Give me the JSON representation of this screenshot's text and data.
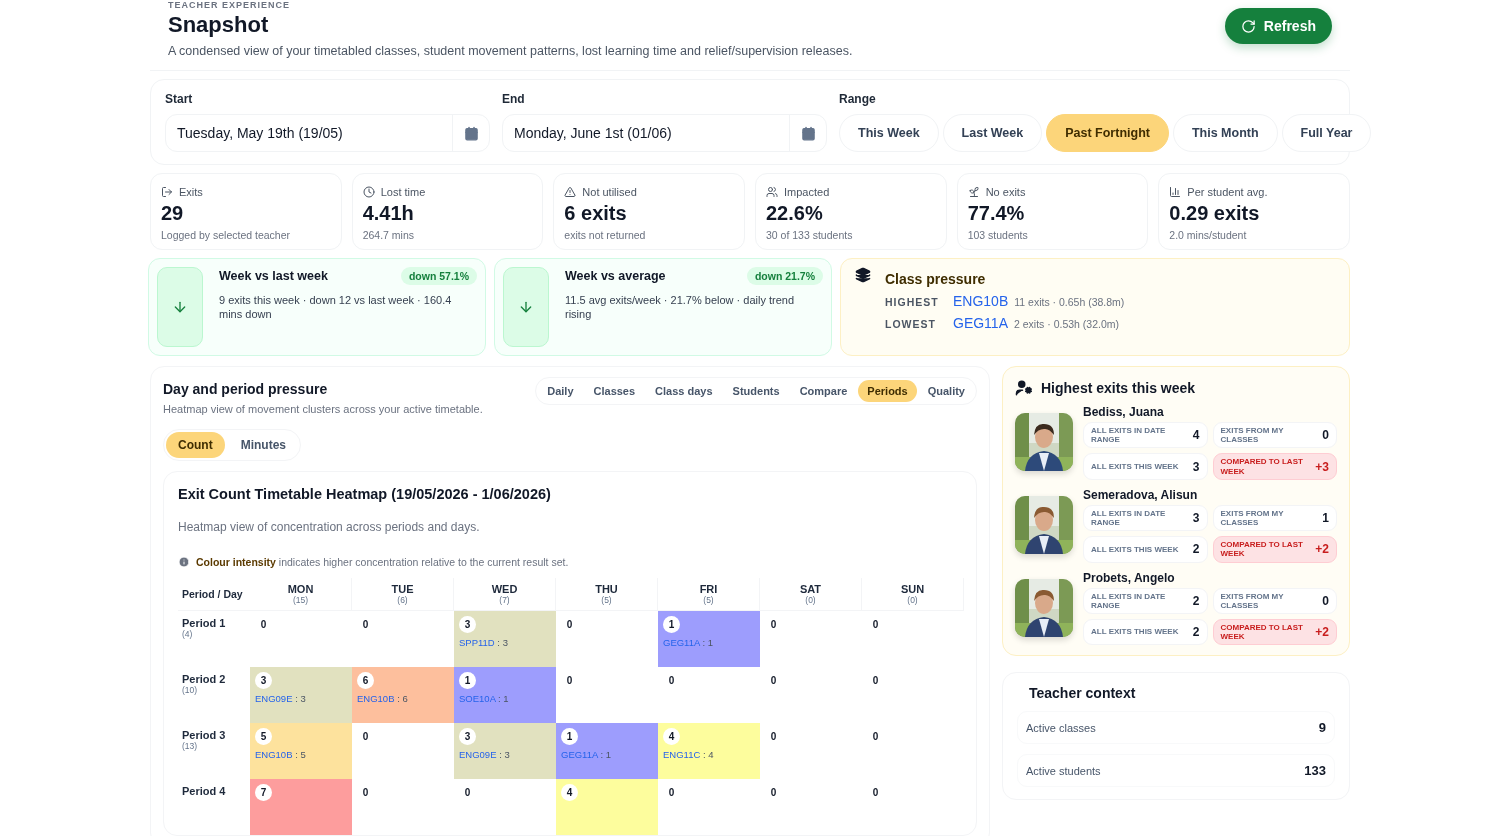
{
  "header": {
    "eyebrow": "TEACHER EXPERIENCE",
    "title": "Snapshot",
    "description": "A condensed view of your timetabled classes, student movement patterns, lost learning time and relief/supervision releases.",
    "refresh_button": "Refresh"
  },
  "filters": {
    "start": {
      "label": "Start",
      "value": "Tuesday, May 19th (19/05)"
    },
    "end": {
      "label": "End",
      "value": "Monday, June 1st (01/06)"
    },
    "range": {
      "label": "Range",
      "options": [
        {
          "label": "This Week",
          "selected": false
        },
        {
          "label": "Last Week",
          "selected": false
        },
        {
          "label": "Past Fortnight",
          "selected": true
        },
        {
          "label": "This Month",
          "selected": false
        },
        {
          "label": "Full Year",
          "selected": false
        }
      ]
    }
  },
  "stats": [
    {
      "kind": "exits",
      "label": "Exits",
      "value": "29",
      "note": "Logged by selected teacher"
    },
    {
      "kind": "clock",
      "label": "Lost time",
      "value": "4.41h",
      "note": "264.7 mins"
    },
    {
      "kind": "warning",
      "label": "Not utilised",
      "value": "6 exits",
      "note": "exits not returned"
    },
    {
      "kind": "people",
      "label": "Impacted",
      "value": "22.6%",
      "note": "30 of 133 students"
    },
    {
      "kind": "sprout",
      "label": "No exits",
      "value": "77.4%",
      "note": "103 students"
    },
    {
      "kind": "bars",
      "label": "Per student avg.",
      "value": "0.29 exits",
      "note": "2.0 mins/student"
    }
  ],
  "trends": [
    {
      "title": "Week vs last week",
      "badge": "down 57.1%",
      "kind": "down",
      "text": "9 exits this week · down 12 vs last week · 160.4 mins down"
    },
    {
      "title": "Week vs average",
      "badge": "down 21.7%",
      "kind": "down",
      "text": "11.5 avg exits/week · 21.7% below · daily trend rising"
    }
  ],
  "class_pressure": {
    "title": "Class pressure",
    "rows": [
      {
        "label": "HIGHEST",
        "class": "ENG10B",
        "detail": "11 exits · 0.65h (38.8m)"
      },
      {
        "label": "LOWEST",
        "class": "GEG11A",
        "detail": "2 exits · 0.53h (32.0m)"
      }
    ]
  },
  "pressure": {
    "title": "Day and period pressure",
    "subtitle": "Heatmap view of movement clusters across your active timetable.",
    "tabs": [
      {
        "label": "Daily",
        "selected": false
      },
      {
        "label": "Classes",
        "selected": false
      },
      {
        "label": "Class days",
        "selected": false
      },
      {
        "label": "Students",
        "selected": false
      },
      {
        "label": "Compare",
        "selected": false
      },
      {
        "label": "Periods",
        "selected": true
      },
      {
        "label": "Quality",
        "selected": false
      }
    ],
    "modes": [
      {
        "label": "Count",
        "selected": true
      },
      {
        "label": "Minutes",
        "selected": false
      }
    ],
    "heatmap": {
      "title": "Exit Count Timetable Heatmap (19/05/2026 - 1/06/2026)",
      "subtitle": "Heatmap view of concentration across periods and days.",
      "note_strong": "Colour intensity",
      "note": "indicates higher concentration relative to the current result set.",
      "corner": "Period / Day",
      "days": [
        {
          "name": "MON",
          "count": "(15)"
        },
        {
          "name": "TUE",
          "count": "(6)"
        },
        {
          "name": "WED",
          "count": "(7)"
        },
        {
          "name": "THU",
          "count": "(5)"
        },
        {
          "name": "FRI",
          "count": "(5)"
        },
        {
          "name": "SAT",
          "count": "(0)"
        },
        {
          "name": "SUN",
          "count": "(0)"
        }
      ],
      "rows": [
        {
          "period": "Period 1",
          "count": "(4)",
          "cells": [
            {
              "value": "0"
            },
            {
              "value": "0"
            },
            {
              "value": "3",
              "class": "SPP11D",
              "detail": " : 3",
              "color": "#e1e1bf"
            },
            {
              "value": "0"
            },
            {
              "value": "1",
              "class": "GEG11A",
              "detail": " : 1",
              "color": "#9d9dfd"
            },
            {
              "value": "0"
            },
            {
              "value": "0"
            }
          ]
        },
        {
          "period": "Period 2",
          "count": "(10)",
          "cells": [
            {
              "value": "3",
              "class": "ENG09E",
              "detail": " : 3",
              "color": "#e1e1bf"
            },
            {
              "value": "6",
              "class": "ENG10B",
              "detail": " : 6",
              "color": "#fdbf9d"
            },
            {
              "value": "1",
              "class": "SOE10A",
              "detail": " : 1",
              "color": "#9d9dfd"
            },
            {
              "value": "0"
            },
            {
              "value": "0"
            },
            {
              "value": "0"
            },
            {
              "value": "0"
            }
          ]
        },
        {
          "period": "Period 3",
          "count": "(13)",
          "cells": [
            {
              "value": "5",
              "class": "ENG10B",
              "detail": " : 5",
              "color": "#fde29d"
            },
            {
              "value": "0"
            },
            {
              "value": "3",
              "class": "ENG09E",
              "detail": " : 3",
              "color": "#e1e1bf"
            },
            {
              "value": "1",
              "class": "GEG11A",
              "detail": " : 1",
              "color": "#9d9dfd"
            },
            {
              "value": "4",
              "class": "ENG11C",
              "detail": " : 4",
              "color": "#fdfd9d"
            },
            {
              "value": "0"
            },
            {
              "value": "0"
            }
          ]
        },
        {
          "period": "Period 4",
          "cells": [
            {
              "value": "7",
              "color": "#fd9d9d"
            },
            {
              "value": "0"
            },
            {
              "value": "0"
            },
            {
              "value": "4",
              "color": "#fdfd9d"
            },
            {
              "value": "0"
            },
            {
              "value": "0"
            },
            {
              "value": "0"
            }
          ]
        }
      ]
    }
  },
  "highest_exits": {
    "title": "Highest exits this week",
    "students": [
      {
        "name": "Bediss, Juana",
        "stats": [
          {
            "label": "ALL EXITS IN DATE RANGE",
            "value": "4",
            "alert": false
          },
          {
            "label": "EXITS FROM MY CLASSES",
            "value": "0",
            "alert": false
          },
          {
            "label": "ALL EXITS THIS WEEK",
            "value": "3",
            "alert": false
          },
          {
            "label": "COMPARED TO LAST WEEK",
            "value": "+3",
            "alert": true
          }
        ]
      },
      {
        "name": "Semeradova, Alisun",
        "stats": [
          {
            "label": "ALL EXITS IN DATE RANGE",
            "value": "3",
            "alert": false
          },
          {
            "label": "EXITS FROM MY CLASSES",
            "value": "1",
            "alert": false
          },
          {
            "label": "ALL EXITS THIS WEEK",
            "value": "2",
            "alert": false
          },
          {
            "label": "COMPARED TO LAST WEEK",
            "value": "+2",
            "alert": true
          }
        ]
      },
      {
        "name": "Probets, Angelo",
        "stats": [
          {
            "label": "ALL EXITS IN DATE RANGE",
            "value": "2",
            "alert": false
          },
          {
            "label": "EXITS FROM MY CLASSES",
            "value": "0",
            "alert": false
          },
          {
            "label": "ALL EXITS THIS WEEK",
            "value": "2",
            "alert": false
          },
          {
            "label": "COMPARED TO LAST WEEK",
            "value": "+2",
            "alert": true
          }
        ]
      }
    ]
  },
  "teacher_context": {
    "title": "Teacher context",
    "rows": [
      {
        "label": "Active classes",
        "value": "9"
      },
      {
        "label": "Active students",
        "value": "133"
      }
    ]
  }
}
